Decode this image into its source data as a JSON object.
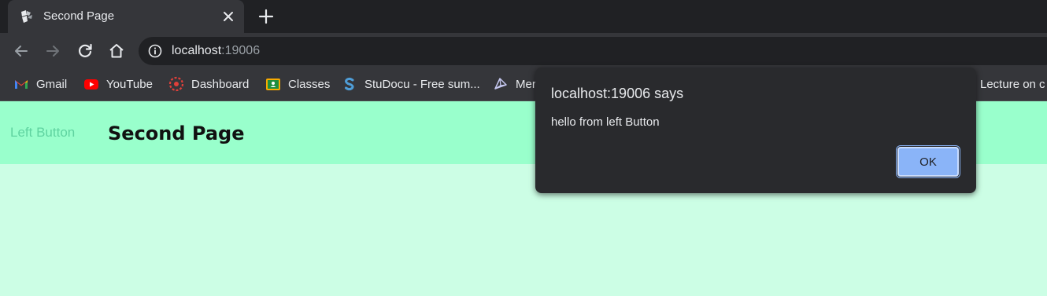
{
  "browser": {
    "tab": {
      "title": "Second Page"
    },
    "address": {
      "host": "localhost",
      "port": ":19006"
    },
    "bookmarks": [
      {
        "label": "Gmail",
        "icon": "gmail-icon"
      },
      {
        "label": "YouTube",
        "icon": "youtube-icon"
      },
      {
        "label": "Dashboard",
        "icon": "dashboard-icon"
      },
      {
        "label": "Classes",
        "icon": "classroom-icon"
      },
      {
        "label": "StuDocu - Free sum...",
        "icon": "studocu-icon"
      },
      {
        "label": "Mer",
        "icon": "bookmark-icon"
      },
      {
        "label": "Lecture on c",
        "icon": ""
      }
    ]
  },
  "page": {
    "left_button": "Left Button",
    "title": "Second Page",
    "colors": {
      "header": "#99ffcc",
      "body": "#ccfee5"
    }
  },
  "alert": {
    "title": "localhost:19006 says",
    "message": "hello from left Button",
    "ok_label": "OK"
  }
}
